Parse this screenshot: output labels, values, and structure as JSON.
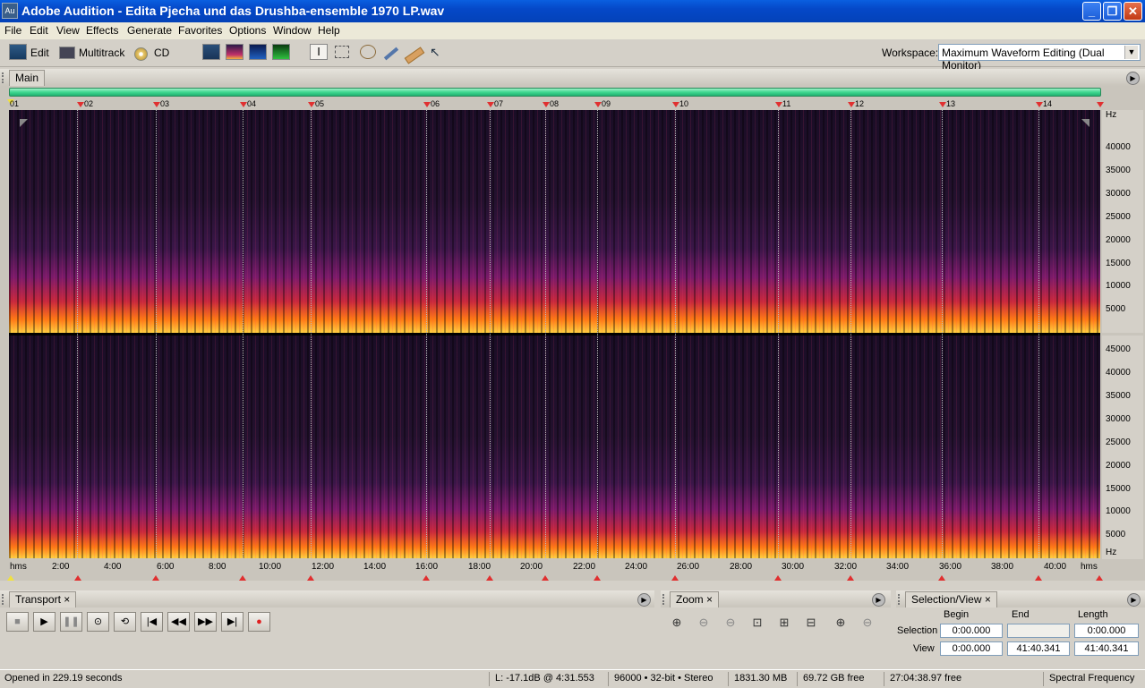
{
  "window": {
    "title": "Adobe Audition - Edita Pjecha und das Drushba-ensemble 1970 LP.wav",
    "app_icon": "Au",
    "minimize": "_",
    "maximize": "❐",
    "close": "✕"
  },
  "menu": [
    "File",
    "Edit",
    "View",
    "Effects",
    "Generate",
    "Favorites",
    "Options",
    "Window",
    "Help"
  ],
  "toolbar": {
    "edit_label": "Edit",
    "multitrack_label": "Multitrack",
    "cd_label": "CD",
    "workspace_label": "Workspace:",
    "workspace_value": "Maximum Waveform Editing (Dual Monitor)"
  },
  "main_panel": {
    "tab": "Main",
    "markers": [
      "01",
      "02",
      "03",
      "04",
      "05",
      "06",
      "07",
      "08",
      "09",
      "10",
      "11",
      "12",
      "13",
      "14"
    ],
    "y_axis_top": {
      "unit": "Hz",
      "ticks": [
        "40000",
        "35000",
        "30000",
        "25000",
        "20000",
        "15000",
        "10000",
        "5000"
      ]
    },
    "y_axis_bottom": {
      "unit": "Hz",
      "ticks": [
        "45000",
        "40000",
        "35000",
        "30000",
        "25000",
        "20000",
        "15000",
        "10000",
        "5000"
      ]
    },
    "x_axis": {
      "unit": "hms",
      "ticks": [
        "2:00",
        "4:00",
        "6:00",
        "8:00",
        "10:00",
        "12:00",
        "14:00",
        "16:00",
        "18:00",
        "20:00",
        "22:00",
        "24:00",
        "26:00",
        "28:00",
        "30:00",
        "32:00",
        "34:00",
        "36:00",
        "38:00",
        "40:00"
      ]
    }
  },
  "transport": {
    "tab": "Transport"
  },
  "zoom": {
    "tab": "Zoom"
  },
  "selection_view": {
    "tab": "Selection/View",
    "col_begin": "Begin",
    "col_end": "End",
    "col_length": "Length",
    "row_selection": "Selection",
    "row_view": "View",
    "selection_begin": "0:00.000",
    "selection_end": "",
    "selection_length": "0:00.000",
    "view_begin": "0:00.000",
    "view_end": "41:40.341",
    "view_length": "41:40.341"
  },
  "status": {
    "opened": "Opened in 229.19 seconds",
    "level": "L: -17.1dB @   4:31.553",
    "format": "96000 • 32-bit • Stereo",
    "memory": "1831.30 MB",
    "disk_free": "69.72 GB free",
    "time_free": "27:04:38.97 free",
    "view_mode": "Spectral Frequency"
  },
  "colors": {
    "titlebar": "#0548c8",
    "spectrogram_bg": "#1a0d26",
    "spectrum_hot": "#ffb400",
    "marker": "#e03030",
    "overview_bar": "#3fe09a"
  }
}
